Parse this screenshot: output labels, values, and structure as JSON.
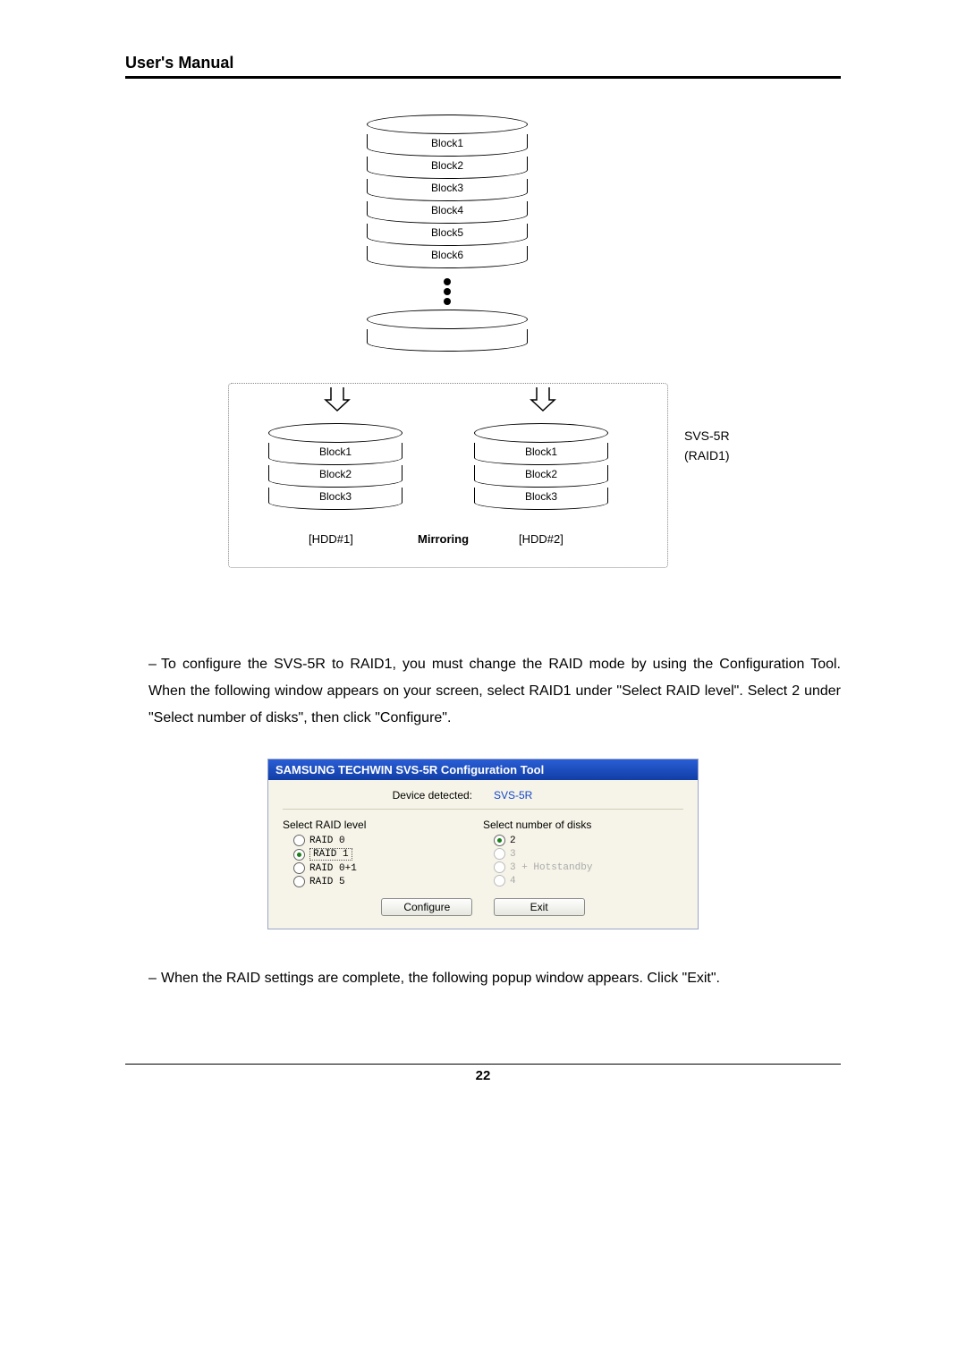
{
  "header": {
    "title": "User's Manual"
  },
  "diagram": {
    "top_blocks": [
      "Block1",
      "Block2",
      "Block3",
      "Block4",
      "Block5",
      "Block6"
    ],
    "hdd1_blocks": [
      "Block1",
      "Block2",
      "Block3"
    ],
    "hdd2_blocks": [
      "Block1",
      "Block2",
      "Block3"
    ],
    "hdd1_label": "[HDD#1]",
    "hdd2_label": "[HDD#2]",
    "mirroring": "Mirroring",
    "side_line1": "SVS-5R",
    "side_line2": "(RAID1)"
  },
  "paragraphs": {
    "p1": "To configure the SVS-5R to RAID1, you must change the RAID mode by using the Configuration Tool. When the following window appears on your screen, select RAID1 under \"Select RAID level\". Select 2 under \"Select number of disks\", then click \"Configure\".",
    "p2": "When the RAID settings are complete, the following popup window appears. Click \"Exit\"."
  },
  "dialog": {
    "title": "SAMSUNG TECHWIN SVS-5R Configuration Tool",
    "device_label": "Device detected:",
    "device_value": "SVS-5R",
    "raid_group": "Select RAID level",
    "raid_options": [
      "RAID 0",
      "RAID 1",
      "RAID 0+1",
      "RAID 5"
    ],
    "raid_selected_index": 1,
    "disks_group": "Select number of disks",
    "disks_options": [
      "2",
      "3",
      "3 + Hotstandby",
      "4"
    ],
    "disks_selected_index": 0,
    "disks_disabled": [
      false,
      true,
      true,
      true
    ],
    "configure": "Configure",
    "exit": "Exit"
  },
  "footer": {
    "page": "22"
  }
}
